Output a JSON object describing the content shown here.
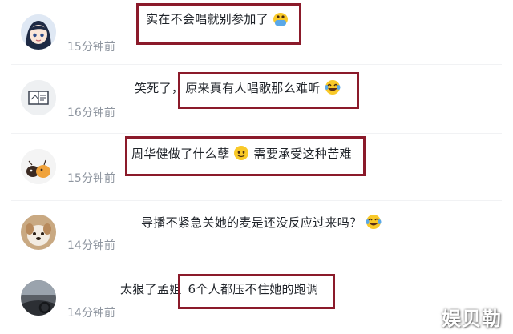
{
  "comments": [
    {
      "text_parts": [
        "实在不会唱就别参加了"
      ],
      "emoji": "pleading-face-emoji",
      "time": "15分钟前",
      "avatar": "anime-girl-avatar"
    },
    {
      "prefix": "笑死了，",
      "text_parts": [
        "原来真有人唱歌那么难听"
      ],
      "emoji": "laughing-tears-emoji",
      "time": "16分钟前",
      "avatar": "book-sketch-avatar"
    },
    {
      "text_parts": [
        "周华健做了什么孽",
        "需要承受这种苦难"
      ],
      "emoji": "smiling-face-emoji",
      "time": "15分钟前",
      "avatar": "cartoon-animals-avatar"
    },
    {
      "text_parts": [
        "导播不紧急关她的麦是还没反应过来吗？"
      ],
      "emoji": "laughing-tears-emoji",
      "time": "14分钟前",
      "avatar": "dog-avatar"
    },
    {
      "prefix": "太狠了孟姐",
      "text_parts": [
        "6个人都压不住她的跑调"
      ],
      "time": "14分钟前",
      "avatar": "car-interior-avatar"
    }
  ],
  "watermark": "娱贝勒",
  "colors": {
    "highlight_border": "#8b1a2a",
    "text": "#1f2329",
    "timestamp": "#8f96a0"
  }
}
